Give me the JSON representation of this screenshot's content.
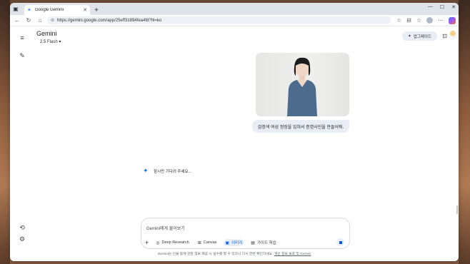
{
  "browser": {
    "tab_title": "Google Gemini",
    "url": "https://gemini.google.com/app/25eff31894fea4fd?hl=ko",
    "new_tab_label": "+"
  },
  "app": {
    "brand": "Gemini",
    "model": "2.5 Flash ▾",
    "upgrade_label": "업그레이드"
  },
  "chat": {
    "user_prompt": "검정색 여성 정장을 입혀서 증명사진을 만들어줘.",
    "loading_text": "잠시만 기다려 주세요..."
  },
  "composer": {
    "placeholder": "Gemini에게 물어보기",
    "tools": [
      {
        "label": "Deep Research",
        "icon": "deep-research-icon"
      },
      {
        "label": "Canvas",
        "icon": "canvas-icon"
      },
      {
        "label": "이미지",
        "icon": "image-icon",
        "active": true
      },
      {
        "label": "가이드 학습",
        "icon": "guided-learning-icon"
      }
    ]
  },
  "footer": {
    "disclaimer": "Gemini는 인물 등에 관한 정보 제공 시 실수를 할 수 있으니 다시 한번 확인하세요.",
    "privacy_link": "개인 정보 보호 및 Gemini"
  },
  "colors": {
    "accent": "#0b57d0",
    "bubble": "#e9eef6"
  }
}
